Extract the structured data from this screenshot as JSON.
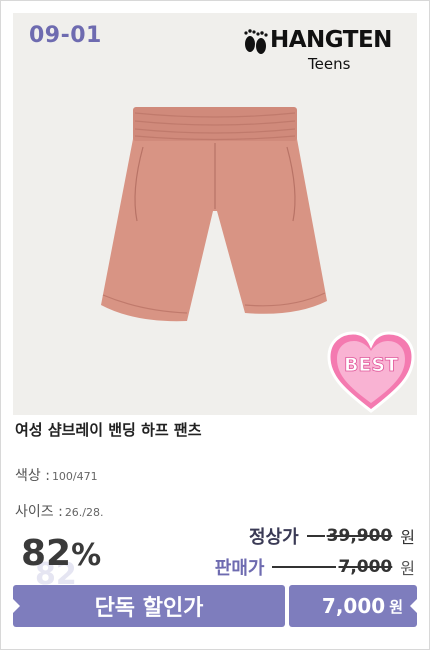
{
  "product": {
    "code": "09-01",
    "brand_name": "HANGTEN",
    "brand_sub": "Teens",
    "title": "여성 샴브레이 밴딩 하프 팬츠",
    "badge": "BEST"
  },
  "details": {
    "color_label": "색상 :",
    "color_value": "100/471",
    "size_label": "사이즈 :",
    "size_value": "26./28."
  },
  "pricing": {
    "discount_number": "82",
    "discount_percent": "%",
    "discount_shadow": "82",
    "regular_label": "정상가",
    "regular_price": "39,900",
    "sale_label": "판매가",
    "sale_price": "7,000",
    "currency": "원"
  },
  "action_bar": {
    "left_label": "단독 할인가",
    "price": "7,000",
    "currency": "원"
  },
  "colors": {
    "accent": "#7e7dbd",
    "shorts": "#d89484",
    "badge_pink": "#f47ab0"
  }
}
